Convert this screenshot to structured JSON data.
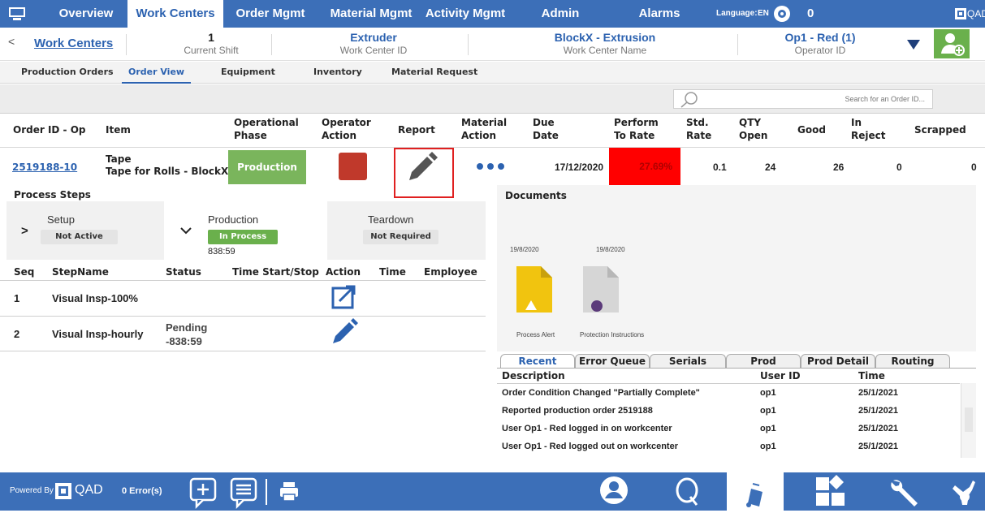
{
  "nav": {
    "tabs": [
      "Overview",
      "Work Centers",
      "Order Mgmt",
      "Material Mgmt",
      "Activity Mgmt",
      "Admin",
      "Alarms"
    ],
    "language_label": "Language:",
    "language_value": "EN",
    "alarm_count": "0",
    "brand": "QAD"
  },
  "header": {
    "back": "<",
    "work_centers": "Work Centers",
    "shift_value": "1",
    "shift_label": "Current Shift",
    "wc_id_value": "Extruder",
    "wc_id_label": "Work Center ID",
    "wc_name_value": "BlockX - Extrusion",
    "wc_name_label": "Work Center Name",
    "operator_value": "Op1 - Red (1)",
    "operator_label": "Operator ID"
  },
  "subtabs": [
    "Production Orders",
    "Order View",
    "Equipment",
    "Inventory",
    "Material Request"
  ],
  "search": {
    "placeholder": "Search for an Order ID..."
  },
  "order_table": {
    "headers": {
      "order_id": "Order ID - Op",
      "item": "Item",
      "phase_1": "Operational",
      "phase_2": "Phase",
      "op_action_1": "Operator",
      "op_action_2": "Action",
      "report": "Report",
      "mat_1": "Material",
      "mat_2": "Action",
      "due_1": "Due",
      "due_2": "Date",
      "perf_1": "Perform",
      "perf_2": "To Rate",
      "std_1": "Std.",
      "std_2": "Rate",
      "qty_1": "QTY",
      "qty_2": "Open",
      "good": "Good",
      "rej_1": "In",
      "rej_2": "Reject",
      "scrapped": "Scrapped"
    },
    "row": {
      "order_id": "2519188-10",
      "item_name": "Tape",
      "item_desc": "Tape for Rolls - BlockX",
      "phase": "Production",
      "due_date": "17/12/2020",
      "perform": "27.69%",
      "std_rate": "0.1",
      "qty_open": "24",
      "good": "26",
      "in_reject": "0",
      "scrapped": "0"
    }
  },
  "process": {
    "title": "Process Steps",
    "phases": [
      {
        "name": "Setup",
        "status": "Not Active"
      },
      {
        "name": "Production",
        "status": "In Process",
        "time": "838:59"
      },
      {
        "name": "Teardown",
        "status": "Not Required"
      }
    ],
    "step_headers": [
      "Seq",
      "StepName",
      "Status",
      "Time Start/Stop",
      "Action",
      "Time",
      "Employee"
    ],
    "steps": [
      {
        "seq": "1",
        "name": "Visual Insp-100%",
        "status": "",
        "time": ""
      },
      {
        "seq": "2",
        "name": "Visual Insp-hourly",
        "status": "Pending",
        "time": "-838:59"
      }
    ]
  },
  "documents": {
    "title": "Documents",
    "items": [
      {
        "date": "19/8/2020",
        "caption": "Process Alert"
      },
      {
        "date": "19/8/2020",
        "caption": "Protection Instructions"
      }
    ]
  },
  "activity": {
    "tabs": [
      "Recent Activity",
      "Error Queue",
      "Serials",
      "Prod Summary",
      "Prod Detail",
      "Routing"
    ],
    "headers": [
      "Description",
      "User ID",
      "Time"
    ],
    "rows": [
      {
        "desc": "Order Condition Changed \"Partially Complete\"",
        "user": "op1",
        "time": "25/1/2021"
      },
      {
        "desc": "Reported production order 2519188",
        "user": "op1",
        "time": "25/1/2021"
      },
      {
        "desc": "User Op1 - Red logged in on workcenter",
        "user": "op1",
        "time": "25/1/2021"
      },
      {
        "desc": "User Op1 - Red logged out on workcenter",
        "user": "op1",
        "time": "25/1/2021"
      }
    ]
  },
  "footer": {
    "powered_by": "Powered By",
    "brand": "QAD",
    "errors": "0 Error(s)"
  },
  "colors": {
    "nav": "#3c6fb8",
    "accent": "#2c62b0",
    "phase_green": "#7ab55c",
    "action_red": "#c0392b",
    "perf_red": "#ff0000",
    "report_highlight": "#e02020"
  }
}
